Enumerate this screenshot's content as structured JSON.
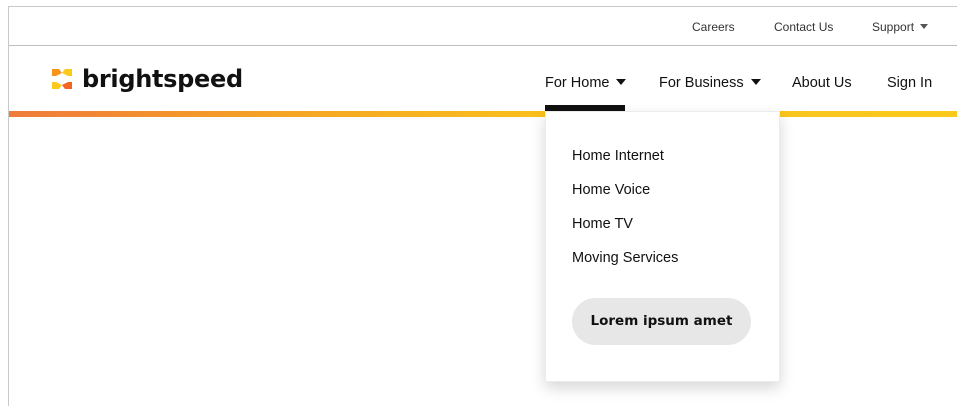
{
  "utility_nav": {
    "careers": "Careers",
    "contact_us": "Contact Us",
    "support": "Support"
  },
  "brand": {
    "name": "brightspeed",
    "colors": {
      "orange": "#f07a3a",
      "yellow": "#fbc91c",
      "dark": "#111111"
    }
  },
  "main_nav": {
    "for_home": "For Home",
    "for_business": "For Business",
    "about_us": "About Us",
    "sign_in": "Sign In",
    "active_item": "For Home"
  },
  "dropdown": {
    "items": [
      {
        "label": "Home Internet"
      },
      {
        "label": "Home Voice"
      },
      {
        "label": "Home TV"
      },
      {
        "label": "Moving Services"
      }
    ],
    "button_label": "Lorem ipsum amet"
  },
  "icons": {
    "utility_caret": "chevron-down-icon",
    "logo_mark": "brightspeed-logo-icon"
  }
}
